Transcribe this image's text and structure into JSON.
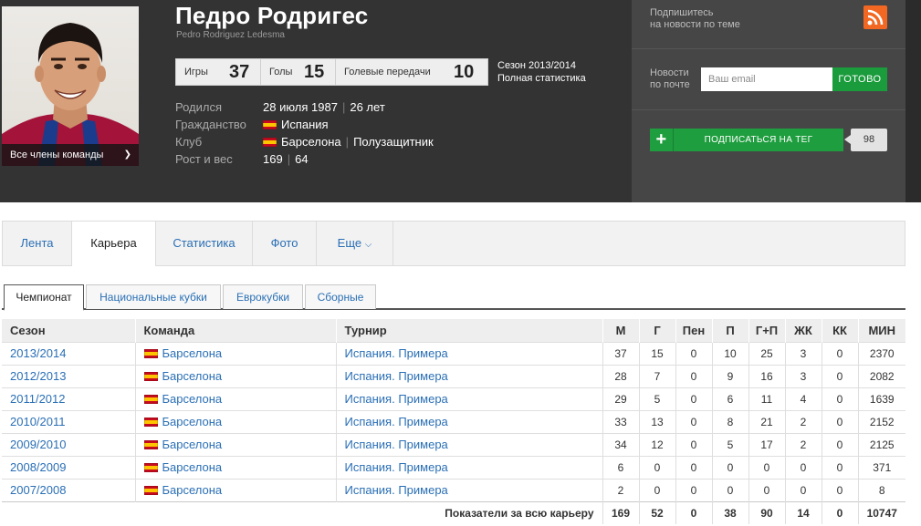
{
  "player": {
    "name": "Педро Родригес",
    "full_name": "Pedro Rodriguez Ledesma",
    "team_dropdown": "Все члены команды"
  },
  "stats": [
    {
      "label": "Игры",
      "value": "37"
    },
    {
      "label": "Голы",
      "value": "15"
    },
    {
      "label": "Голевые передачи",
      "value": "10"
    }
  ],
  "season": {
    "label": "Сезон 2013/2014",
    "link": "Полная статистика"
  },
  "info": {
    "born_label": "Родился",
    "born_date": "28 июля 1987",
    "age": "26 лет",
    "citizenship_label": "Гражданство",
    "citizenship": "Испания",
    "club_label": "Клуб",
    "club": "Барселона",
    "position": "Полузащитник",
    "size_label": "Рост и вес",
    "height": "169",
    "weight": "64"
  },
  "sidebar": {
    "subscribe_label": "Подпишитесь\nна новости по теме",
    "mail_label": "Новости\nпо почте",
    "email_placeholder": "Ваш email",
    "go_label": "ГОТОВО",
    "tag_label": "ПОДПИСАТЬСЯ НА ТЕГ",
    "tag_count": "98"
  },
  "nav": [
    "Лента",
    "Карьера",
    "Статистика",
    "Фото",
    "Еще"
  ],
  "subtabs": [
    "Чемпионат",
    "Национальные кубки",
    "Еврокубки",
    "Сборные"
  ],
  "table": {
    "headers": [
      "Сезон",
      "Команда",
      "Турнир",
      "М",
      "Г",
      "Пен",
      "П",
      "Г+П",
      "ЖК",
      "КК",
      "МИН"
    ],
    "rows": [
      [
        "2013/2014",
        "Барселона",
        "Испания. Примера",
        "37",
        "15",
        "0",
        "10",
        "25",
        "3",
        "0",
        "2370"
      ],
      [
        "2012/2013",
        "Барселона",
        "Испания. Примера",
        "28",
        "7",
        "0",
        "9",
        "16",
        "3",
        "0",
        "2082"
      ],
      [
        "2011/2012",
        "Барселона",
        "Испания. Примера",
        "29",
        "5",
        "0",
        "6",
        "11",
        "4",
        "0",
        "1639"
      ],
      [
        "2010/2011",
        "Барселона",
        "Испания. Примера",
        "33",
        "13",
        "0",
        "8",
        "21",
        "2",
        "0",
        "2152"
      ],
      [
        "2009/2010",
        "Барселона",
        "Испания. Примера",
        "34",
        "12",
        "0",
        "5",
        "17",
        "2",
        "0",
        "2125"
      ],
      [
        "2008/2009",
        "Барселона",
        "Испания. Примера",
        "6",
        "0",
        "0",
        "0",
        "0",
        "0",
        "0",
        "371"
      ],
      [
        "2007/2008",
        "Барселона",
        "Испания. Примера",
        "2",
        "0",
        "0",
        "0",
        "0",
        "0",
        "0",
        "8"
      ]
    ],
    "total_label": "Показатели за всю карьеру",
    "totals": [
      "169",
      "52",
      "0",
      "38",
      "90",
      "14",
      "0",
      "10747"
    ]
  }
}
